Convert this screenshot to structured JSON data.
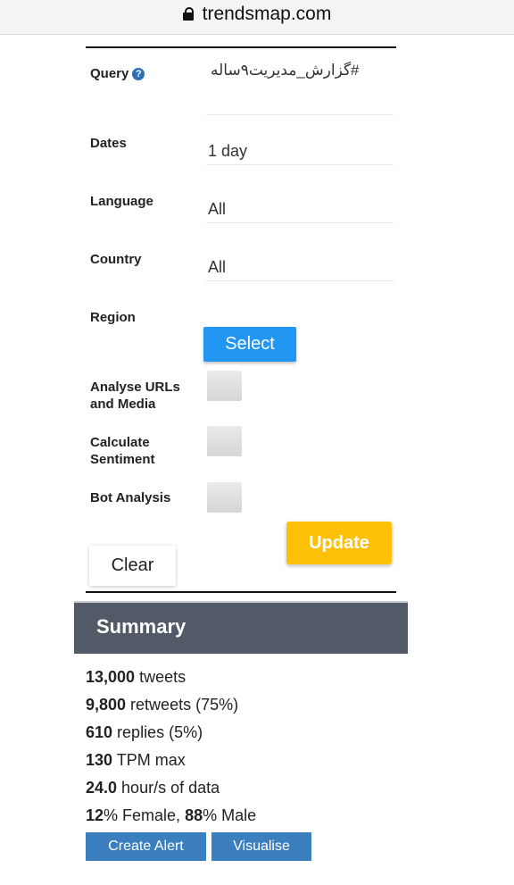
{
  "browser": {
    "url": "trendsmap.com"
  },
  "form": {
    "query_label": "Query",
    "query_help": "?",
    "query_value": "#گزارش_مدیریت۹ساله",
    "dates_label": "Dates",
    "dates_value": "1 day",
    "language_label": "Language",
    "language_value": "All",
    "country_label": "Country",
    "country_value": "All",
    "region_label": "Region",
    "select_label": "Select",
    "urls_label_1": "Analyse URLs",
    "urls_label_2": "and Media",
    "sentiment_label_1": "Calculate",
    "sentiment_label_2": "Sentiment",
    "bot_label": "Bot Analysis",
    "update_label": "Update",
    "clear_label": "Clear"
  },
  "summary": {
    "title": "Summary",
    "tweets_num": "13,000",
    "tweets_text": " tweets",
    "retweets_num": "9,800",
    "retweets_text": " retweets (75%)",
    "replies_num": "610",
    "replies_text": " replies (5%)",
    "tpm_num": "130",
    "tpm_text": " TPM max",
    "hours_num": "24.0",
    "hours_text": " hour/s of data",
    "female_num": "12",
    "female_text": "% Female, ",
    "male_num": "88",
    "male_text": "% Male",
    "create_alert_label": "Create Alert",
    "visualise_label": "Visualise"
  },
  "colors": {
    "primary": "#2196f3",
    "update": "#ffc107",
    "header": "#515a66",
    "action": "#3b7fbf"
  },
  "icons": [
    "lock-icon",
    "help-icon"
  ]
}
